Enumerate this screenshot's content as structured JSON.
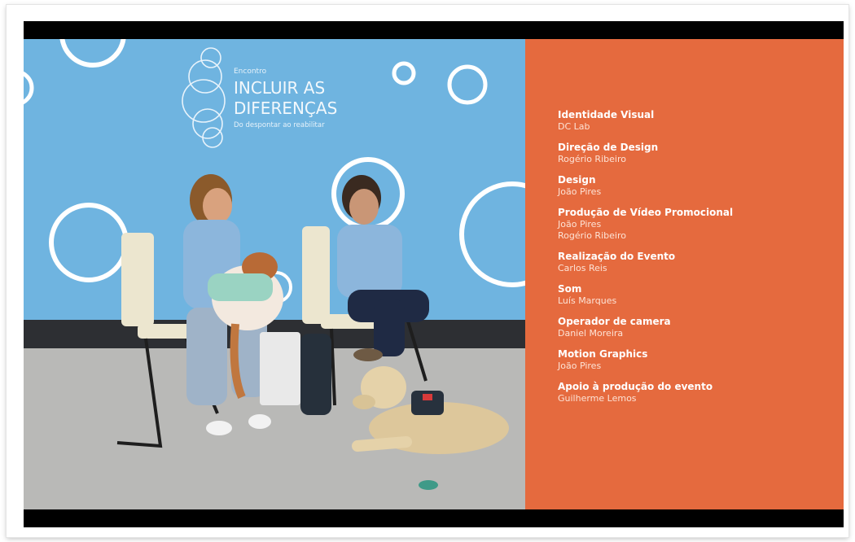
{
  "banner": {
    "kicker": "Encontro",
    "title_line1": "INCLUIR AS",
    "title_line2": "DIFERENÇAS",
    "subtitle": "Do despontar ao reabilitar"
  },
  "credits": [
    {
      "role": "Identidade Visual",
      "names": [
        "DC Lab"
      ]
    },
    {
      "role": "Direção de Design",
      "names": [
        "Rogério Ribeiro"
      ]
    },
    {
      "role": "Design",
      "names": [
        "João Pires"
      ]
    },
    {
      "role": "Produção de Vídeo Promocional",
      "names": [
        "João Pires",
        "Rogério Ribeiro"
      ]
    },
    {
      "role": "Realização do Evento",
      "names": [
        "Carlos Reis"
      ]
    },
    {
      "role": "Som",
      "names": [
        "Luís Marques"
      ]
    },
    {
      "role": "Operador de camera",
      "names": [
        "Daniel Moreira"
      ]
    },
    {
      "role": "Motion Graphics",
      "names": [
        "João Pires"
      ]
    },
    {
      "role": "Apoio à produção do evento",
      "names": [
        "Guilherme Lemos"
      ]
    }
  ],
  "colors": {
    "panel": "#e56a3e",
    "backdrop": "#6fb4e0",
    "letterbox": "#000000"
  }
}
